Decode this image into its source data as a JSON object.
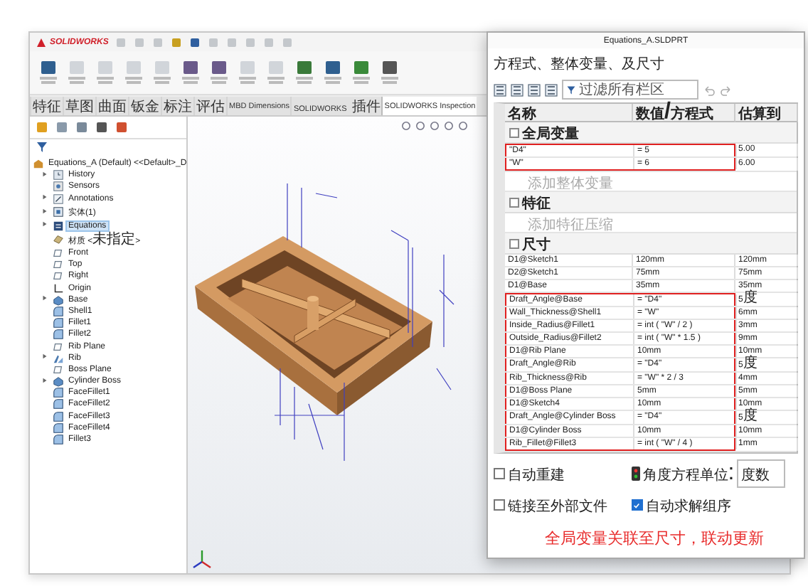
{
  "app": {
    "logo": "SOLIDWORKS"
  },
  "ribbon_tabs": [
    {
      "label": "特征",
      "selected": false
    },
    {
      "label": "草图",
      "selected": false
    },
    {
      "label": "曲面",
      "selected": false
    },
    {
      "label": "钣金",
      "selected": false
    },
    {
      "label": "标注",
      "selected": false
    },
    {
      "label": "评估",
      "selected": false
    },
    {
      "label": "MBD Dimensions",
      "selected": false
    },
    {
      "label": "SOLIDWORKS 插件",
      "selected": false
    },
    {
      "label": "SOLIDWORKS Inspection",
      "selected": true
    }
  ],
  "feature_tree": {
    "root": "Equations_A (Default) <<Default>_D",
    "items": [
      {
        "label": "History",
        "kind": "history",
        "collapsed": true,
        "selected": false
      },
      {
        "label": "Sensors",
        "kind": "sensor",
        "collapsed": false,
        "selected": false
      },
      {
        "label": "Annotations",
        "kind": "annotation",
        "collapsed": true,
        "selected": false
      },
      {
        "label": "实体(1)",
        "kind": "body",
        "collapsed": true,
        "selected": false
      },
      {
        "label": "Equations",
        "kind": "equation",
        "collapsed": true,
        "selected": true
      },
      {
        "label": "材质 <未指定>",
        "kind": "material",
        "collapsed": false,
        "selected": false
      },
      {
        "label": "Front",
        "kind": "plane",
        "collapsed": false,
        "selected": false
      },
      {
        "label": "Top",
        "kind": "plane",
        "collapsed": false,
        "selected": false
      },
      {
        "label": "Right",
        "kind": "plane",
        "collapsed": false,
        "selected": false
      },
      {
        "label": "Origin",
        "kind": "origin",
        "collapsed": false,
        "selected": false
      },
      {
        "label": "Base",
        "kind": "extrude",
        "collapsed": true,
        "selected": false
      },
      {
        "label": "Shell1",
        "kind": "fillet",
        "collapsed": false,
        "selected": false
      },
      {
        "label": "Fillet1",
        "kind": "fillet",
        "collapsed": false,
        "selected": false
      },
      {
        "label": "Fillet2",
        "kind": "fillet",
        "collapsed": false,
        "selected": false
      },
      {
        "label": "Rib Plane",
        "kind": "plane",
        "collapsed": false,
        "selected": false
      },
      {
        "label": "Rib",
        "kind": "rib",
        "collapsed": true,
        "selected": false
      },
      {
        "label": "Boss Plane",
        "kind": "plane",
        "collapsed": false,
        "selected": false
      },
      {
        "label": "Cylinder Boss",
        "kind": "extrude",
        "collapsed": true,
        "selected": false
      },
      {
        "label": "FaceFillet1",
        "kind": "fillet",
        "collapsed": false,
        "selected": false
      },
      {
        "label": "FaceFillet2",
        "kind": "fillet",
        "collapsed": false,
        "selected": false
      },
      {
        "label": "FaceFillet3",
        "kind": "fillet",
        "collapsed": false,
        "selected": false
      },
      {
        "label": "FaceFillet4",
        "kind": "fillet",
        "collapsed": false,
        "selected": false
      },
      {
        "label": "Fillet3",
        "kind": "fillet",
        "collapsed": false,
        "selected": false
      }
    ]
  },
  "dialog": {
    "title": "Equations_A.SLDPRT",
    "subtitle": "方程式、整体变量、及尺寸",
    "filter": {
      "placeholder": "过滤所有栏区"
    },
    "columns": [
      "名称",
      "数值/方程式",
      "估算到"
    ],
    "sections": [
      {
        "title": "全局变量",
        "add_placeholder": "添加整体变量",
        "rows": [
          {
            "name": "\"D4\"",
            "value": "= 5",
            "evaluates": "5.00",
            "highlighted": true
          },
          {
            "name": "\"W\"",
            "value": "= 6",
            "evaluates": "6.00",
            "highlighted": true
          }
        ]
      },
      {
        "title": "特征",
        "add_placeholder": "添加特征压缩"
      },
      {
        "title": "尺寸",
        "rows": [
          {
            "name": "D1@Sketch1",
            "value": "120mm",
            "evaluates": "120mm",
            "highlighted": false
          },
          {
            "name": "D2@Sketch1",
            "value": "75mm",
            "evaluates": "75mm",
            "highlighted": false
          },
          {
            "name": "D1@Base",
            "value": "35mm",
            "evaluates": "35mm",
            "highlighted": false
          },
          {
            "name": "Draft_Angle@Base",
            "value": "= \"D4\"",
            "evaluates": "5度",
            "highlighted": true
          },
          {
            "name": "Wall_Thickness@Shell1",
            "value": "= \"W\"",
            "evaluates": "6mm",
            "highlighted": true
          },
          {
            "name": "Inside_Radius@Fillet1",
            "value": "= int ( \"W\" / 2 )",
            "evaluates": "3mm",
            "highlighted": true
          },
          {
            "name": "Outside_Radius@Fillet2",
            "value": "= int ( \"W\" * 1.5 )",
            "evaluates": "9mm",
            "highlighted": true
          },
          {
            "name": "D1@Rib Plane",
            "value": "10mm",
            "evaluates": "10mm",
            "highlighted": true
          },
          {
            "name": "Draft_Angle@Rib",
            "value": "= \"D4\"",
            "evaluates": "5度",
            "highlighted": true
          },
          {
            "name": "Rib_Thickness@Rib",
            "value": "= \"W\" * 2 / 3",
            "evaluates": "4mm",
            "highlighted": true
          },
          {
            "name": "D1@Boss Plane",
            "value": "5mm",
            "evaluates": "5mm",
            "highlighted": true
          },
          {
            "name": "D1@Sketch4",
            "value": "10mm",
            "evaluates": "10mm",
            "highlighted": true
          },
          {
            "name": "Draft_Angle@Cylinder Boss",
            "value": "= \"D4\"",
            "evaluates": "5度",
            "highlighted": true
          },
          {
            "name": "D1@Cylinder Boss",
            "value": "10mm",
            "evaluates": "10mm",
            "highlighted": true
          },
          {
            "name": "Rib_Fillet@Fillet3",
            "value": "= int ( \"W\" / 4 )",
            "evaluates": "1mm",
            "highlighted": true
          }
        ]
      }
    ],
    "options": {
      "auto_rebuild": {
        "label": "自动重建",
        "checked": false
      },
      "angle_unit": {
        "label": "角度方程单位:",
        "value": "度数"
      },
      "link_external": {
        "label": "链接至外部文件",
        "checked": false
      },
      "auto_solve": {
        "label": "自动求解组序",
        "checked": true
      }
    },
    "annotation": "全局变量关联至尺寸，联动更新"
  }
}
